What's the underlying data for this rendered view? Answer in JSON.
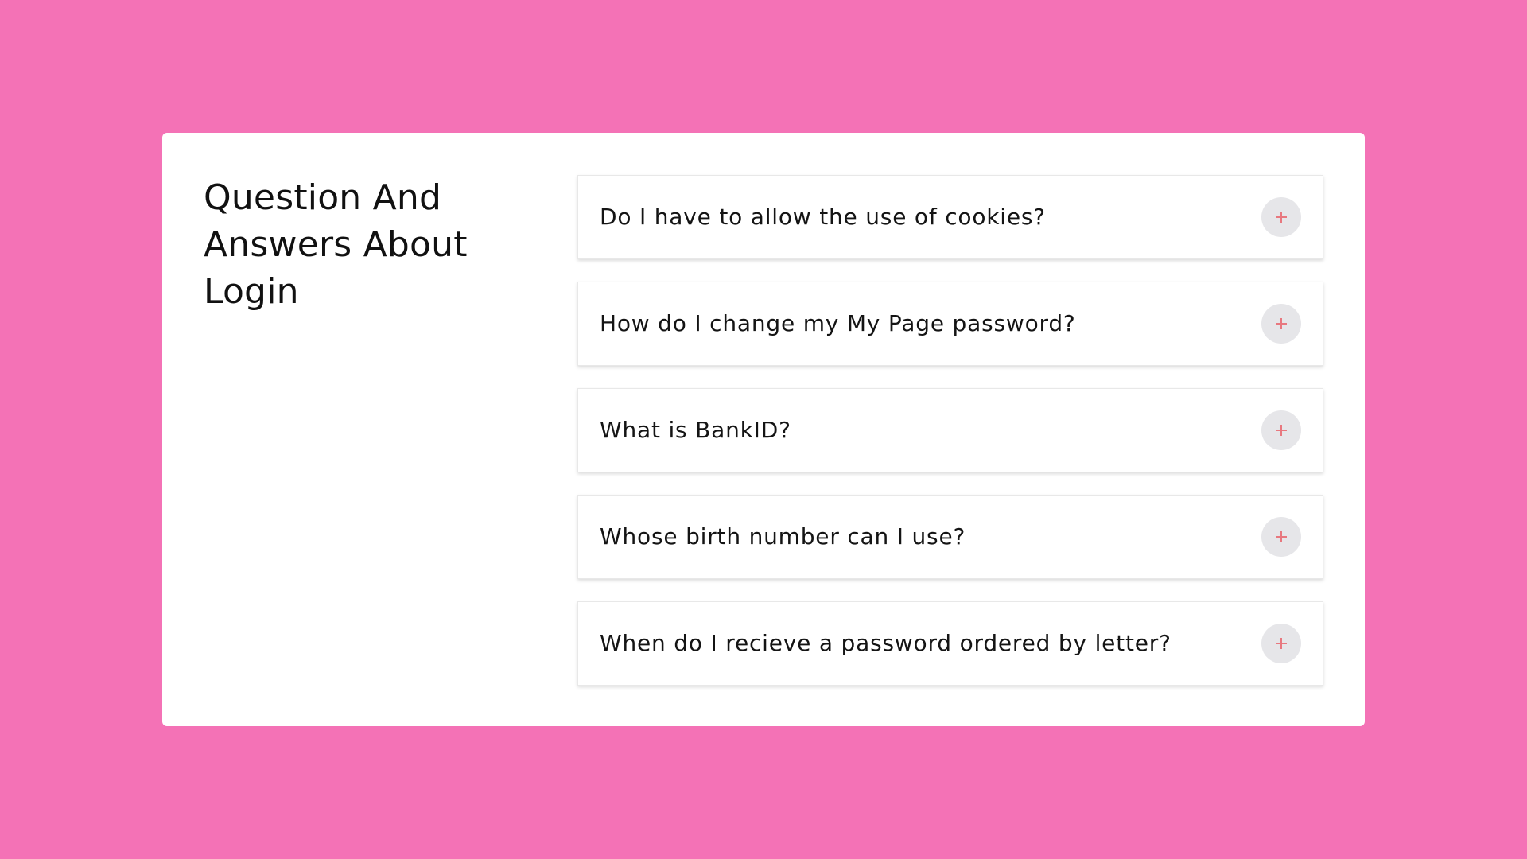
{
  "colors": {
    "background": "#f472b6",
    "card": "#ffffff",
    "toggle_background": "#e6e6e9",
    "plus_icon": "#e8787f"
  },
  "faq": {
    "title": "Question And Answers About Login",
    "items": [
      {
        "question": "Do I have to allow the use of cookies?",
        "icon": "plus-icon"
      },
      {
        "question": "How do I change my My Page password?",
        "icon": "plus-icon"
      },
      {
        "question": "What is BankID?",
        "icon": "plus-icon"
      },
      {
        "question": "Whose birth number can I use?",
        "icon": "plus-icon"
      },
      {
        "question": "When do I recieve a password ordered by letter?",
        "icon": "plus-icon"
      }
    ]
  }
}
